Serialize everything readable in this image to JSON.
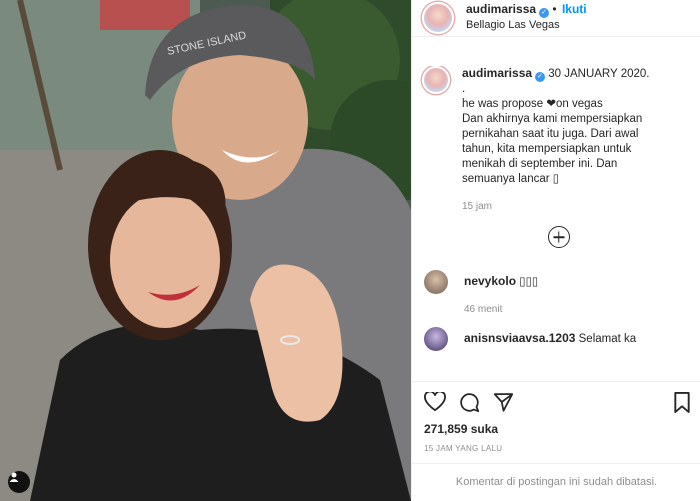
{
  "header": {
    "username": "audimarissa",
    "follow_label": "Ikuti",
    "location": "Bellagio Las Vegas"
  },
  "caption": {
    "username": "audimarissa",
    "date": "30 JANUARY 2020.",
    "lines": [
      ".",
      "he was propose ❤on vegas",
      "Dan akhirnya kami mempersiapkan",
      "pernikahan saat itu juga. Dari awal",
      "tahun, kita mempersiapkan untuk",
      "menikah di september ini. Dan",
      "semuanya lancar ▯"
    ],
    "time": "15 jam"
  },
  "comments": [
    {
      "username": "nevykolo",
      "text": "▯▯▯",
      "time": "46 menit"
    },
    {
      "username": "anisnsviaavsa.1203",
      "text": "Selamat ka"
    }
  ],
  "actions": {
    "likes": "271,859 suka",
    "posted_ago": "15 JAM YANG LALU"
  },
  "footer": {
    "comments_disabled": "Komentar di postingan ini sudah dibatasi."
  },
  "photo": {
    "beanie_text": "STONE ISLAND"
  },
  "colors": {
    "accent": "#0095f6",
    "verified": "#3897f0",
    "muted": "#8e8e8e"
  }
}
